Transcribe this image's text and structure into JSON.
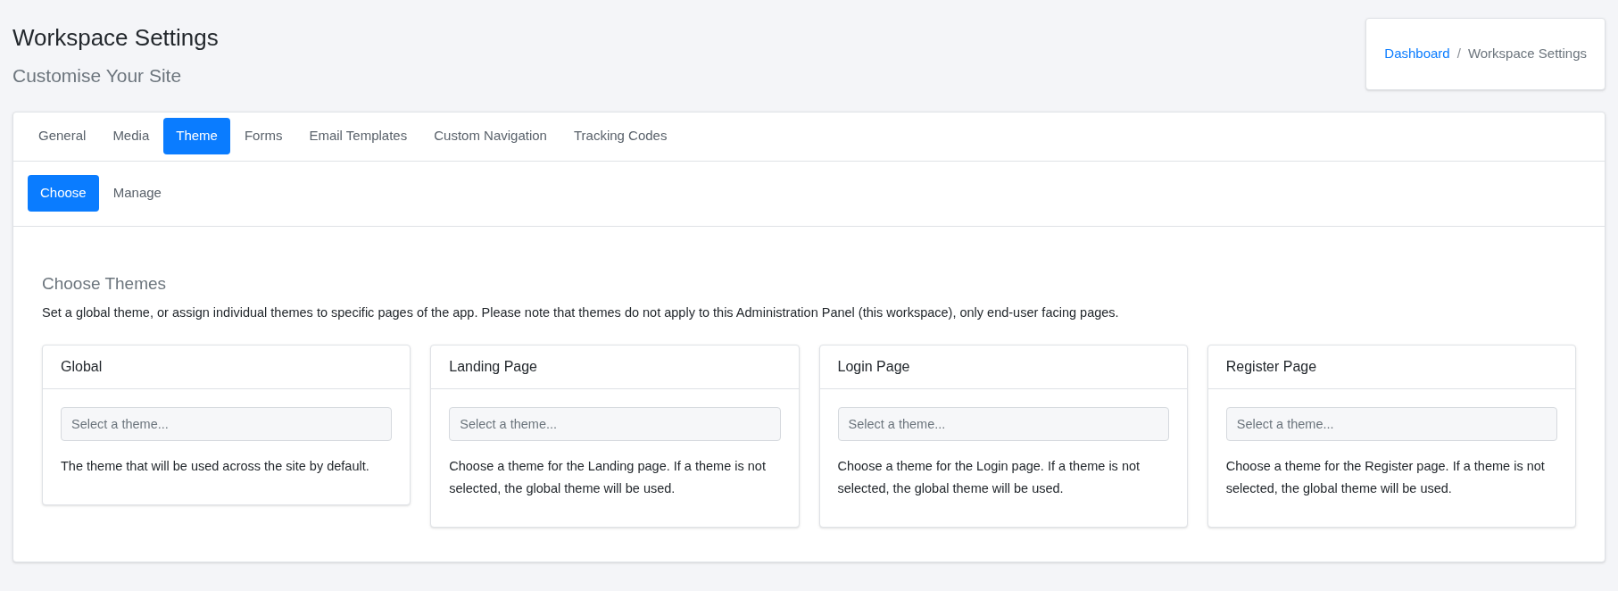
{
  "header": {
    "title": "Workspace Settings",
    "subtitle": "Customise Your Site"
  },
  "breadcrumb": {
    "separator": "/",
    "items": [
      {
        "label": "Dashboard",
        "link": true
      },
      {
        "label": "Workspace Settings",
        "link": false
      }
    ]
  },
  "tabs": [
    {
      "label": "General",
      "selected": false
    },
    {
      "label": "Media",
      "selected": false
    },
    {
      "label": "Theme",
      "selected": true
    },
    {
      "label": "Forms",
      "selected": false
    },
    {
      "label": "Email Templates",
      "selected": false
    },
    {
      "label": "Custom Navigation",
      "selected": false
    },
    {
      "label": "Tracking Codes",
      "selected": false
    }
  ],
  "subtabs": [
    {
      "label": "Choose",
      "selected": true
    },
    {
      "label": "Manage",
      "selected": false
    }
  ],
  "section": {
    "title": "Choose Themes",
    "description": "Set a global theme, or assign individual themes to specific pages of the app. Please note that themes do not apply to this Administration Panel (this workspace), only end-user facing pages."
  },
  "theme_cards": [
    {
      "title": "Global",
      "placeholder": "Select a theme...",
      "help": "The theme that will be used across the site by default."
    },
    {
      "title": "Landing Page",
      "placeholder": "Select a theme...",
      "help": "Choose a theme for the Landing page. If a theme is not selected, the global theme will be used."
    },
    {
      "title": "Login Page",
      "placeholder": "Select a theme...",
      "help": "Choose a theme for the Login page. If a theme is not selected, the global theme will be used."
    },
    {
      "title": "Register Page",
      "placeholder": "Select a theme...",
      "help": "Choose a theme for the Register page. If a theme is not selected, the global theme will be used."
    }
  ]
}
